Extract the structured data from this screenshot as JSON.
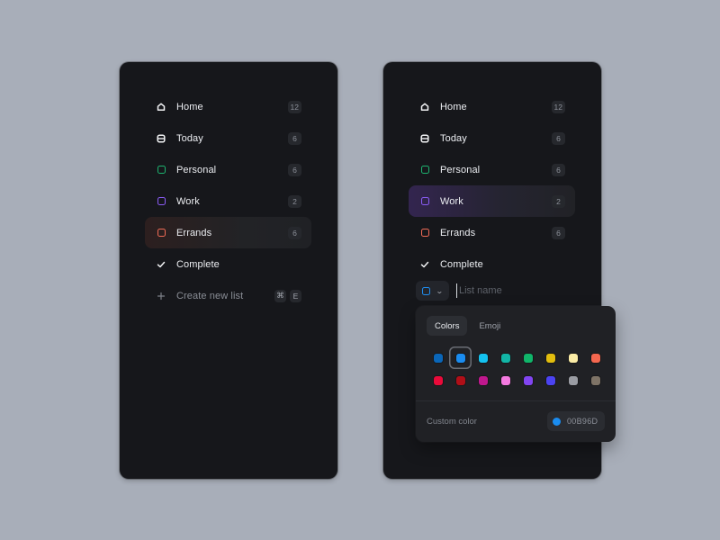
{
  "colors": {
    "background": "#a8aeb9",
    "panel": "#16171b",
    "personal": "#1db36f",
    "work": "#8b5cf6",
    "errands": "#f06b56",
    "selected_custom": "#1f8ef1"
  },
  "left_panel": {
    "items": [
      {
        "label": "Home",
        "icon": "home-icon",
        "count": "12"
      },
      {
        "label": "Today",
        "icon": "calendar-icon",
        "count": "6"
      },
      {
        "label": "Personal",
        "icon": "list-square-icon",
        "color": "#1db36f",
        "count": "6"
      },
      {
        "label": "Work",
        "icon": "list-square-icon",
        "color": "#8b5cf6",
        "count": "2"
      },
      {
        "label": "Errands",
        "icon": "list-square-icon",
        "color": "#f06b56",
        "count": "6",
        "active": true
      },
      {
        "label": "Complete",
        "icon": "check-icon"
      }
    ],
    "create": {
      "label": "Create new list",
      "icon": "plus-icon",
      "shortcut": [
        "⌘",
        "E"
      ]
    }
  },
  "right_panel": {
    "items": [
      {
        "label": "Home",
        "icon": "home-icon",
        "count": "12"
      },
      {
        "label": "Today",
        "icon": "calendar-icon",
        "count": "6"
      },
      {
        "label": "Personal",
        "icon": "list-square-icon",
        "color": "#1db36f",
        "count": "6"
      },
      {
        "label": "Work",
        "icon": "list-square-icon",
        "color": "#8b5cf6",
        "count": "2",
        "active": true
      },
      {
        "label": "Errands",
        "icon": "list-square-icon",
        "color": "#f06b56",
        "count": "6"
      },
      {
        "label": "Complete",
        "icon": "check-icon"
      }
    ],
    "new_list": {
      "placeholder": "List name",
      "value": "",
      "chevron": "chevron-down-icon"
    }
  },
  "popover": {
    "tabs": [
      {
        "label": "Colors",
        "active": true
      },
      {
        "label": "Emoji",
        "active": false
      }
    ],
    "swatches": [
      {
        "color": "#0a66b8"
      },
      {
        "color": "#1a8cf0",
        "selected": true
      },
      {
        "color": "#14c2f0"
      },
      {
        "color": "#12b5a6"
      },
      {
        "color": "#10b56a"
      },
      {
        "color": "#e2bd0e"
      },
      {
        "color": "#fbeca6"
      },
      {
        "color": "#f5674f"
      },
      {
        "color": "#ea0a3a"
      },
      {
        "color": "#b00f18"
      },
      {
        "color": "#c0188e"
      },
      {
        "color": "#f47ae0"
      },
      {
        "color": "#8245f2"
      },
      {
        "color": "#4b43f2"
      },
      {
        "color": "#9a9ca3"
      },
      {
        "color": "#7e7366"
      }
    ],
    "custom_label": "Custom color",
    "custom_value": "00B96D",
    "custom_dot_color": "#1a8cf0"
  }
}
